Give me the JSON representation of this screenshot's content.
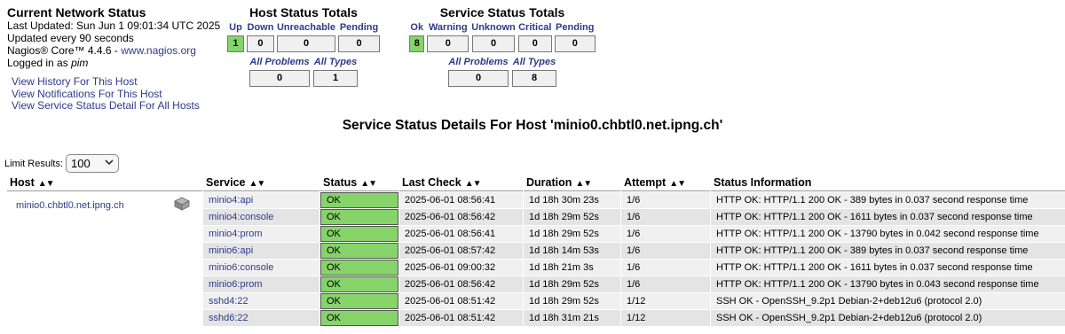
{
  "info": {
    "title": "Current Network Status",
    "last_updated": "Last Updated: Sun Jun 1 09:01:34 UTC 2025",
    "update_interval": "Updated every 90 seconds",
    "version_prefix": "Nagios® Core™ 4.4.6 - ",
    "version_link": "www.nagios.org",
    "logged_prefix": "Logged in as ",
    "user": "pim"
  },
  "links": [
    "View History For This Host",
    "View Notifications For This Host",
    "View Service Status Detail For All Hosts"
  ],
  "host_totals": {
    "title": "Host Status Totals",
    "headers": [
      "Up",
      "Down",
      "Unreachable",
      "Pending"
    ],
    "values": [
      "1",
      "0",
      "0",
      "0"
    ],
    "problem_headers": [
      "All Problems",
      "All Types"
    ],
    "problem_values": [
      "0",
      "1"
    ]
  },
  "service_totals": {
    "title": "Service Status Totals",
    "headers": [
      "Ok",
      "Warning",
      "Unknown",
      "Critical",
      "Pending"
    ],
    "values": [
      "8",
      "0",
      "0",
      "0",
      "0"
    ],
    "problem_headers": [
      "All Problems",
      "All Types"
    ],
    "problem_values": [
      "0",
      "8"
    ]
  },
  "page_title": "Service Status Details For Host 'minio0.chbtl0.net.ipng.ch'",
  "limit": {
    "label": "Limit Results:",
    "value": "100"
  },
  "table": {
    "headers": [
      "Host",
      "Service",
      "Status",
      "Last Check",
      "Duration",
      "Attempt",
      "Status Information"
    ],
    "host": "minio0.chbtl0.net.ipng.ch",
    "host_icon": "server-icon",
    "rows": [
      {
        "service": "minio4:api",
        "status": "OK",
        "last_check": "2025-06-01 08:56:41",
        "duration": "1d 18h 30m 23s",
        "attempt": "1/6",
        "info": "HTTP OK: HTTP/1.1 200 OK - 389 bytes in 0.037 second response time"
      },
      {
        "service": "minio4:console",
        "status": "OK",
        "last_check": "2025-06-01 08:56:42",
        "duration": "1d 18h 29m 52s",
        "attempt": "1/6",
        "info": "HTTP OK: HTTP/1.1 200 OK - 1611 bytes in 0.037 second response time"
      },
      {
        "service": "minio4:prom",
        "status": "OK",
        "last_check": "2025-06-01 08:56:41",
        "duration": "1d 18h 29m 52s",
        "attempt": "1/6",
        "info": "HTTP OK: HTTP/1.1 200 OK - 13790 bytes in 0.042 second response time"
      },
      {
        "service": "minio6:api",
        "status": "OK",
        "last_check": "2025-06-01 08:57:42",
        "duration": "1d 18h 14m 53s",
        "attempt": "1/6",
        "info": "HTTP OK: HTTP/1.1 200 OK - 389 bytes in 0.037 second response time"
      },
      {
        "service": "minio6:console",
        "status": "OK",
        "last_check": "2025-06-01 09:00:32",
        "duration": "1d 18h 21m 3s",
        "attempt": "1/6",
        "info": "HTTP OK: HTTP/1.1 200 OK - 1611 bytes in 0.037 second response time"
      },
      {
        "service": "minio6:prom",
        "status": "OK",
        "last_check": "2025-06-01 08:56:42",
        "duration": "1d 18h 29m 52s",
        "attempt": "1/6",
        "info": "HTTP OK: HTTP/1.1 200 OK - 13790 bytes in 0.043 second response time"
      },
      {
        "service": "sshd4:22",
        "status": "OK",
        "last_check": "2025-06-01 08:51:42",
        "duration": "1d 18h 29m 52s",
        "attempt": "1/12",
        "info": "SSH OK - OpenSSH_9.2p1 Debian-2+deb12u6 (protocol 2.0)"
      },
      {
        "service": "sshd6:22",
        "status": "OK",
        "last_check": "2025-06-01 08:51:42",
        "duration": "1d 18h 31m 21s",
        "attempt": "1/12",
        "info": "SSH OK - OpenSSH_9.2p1 Debian-2+deb12u6 (protocol 2.0)"
      }
    ]
  },
  "colors": {
    "ok": "#86d36a",
    "link": "#2e3a8c",
    "row_odd": "#f0f0f0",
    "row_even": "#e4e4e4"
  }
}
